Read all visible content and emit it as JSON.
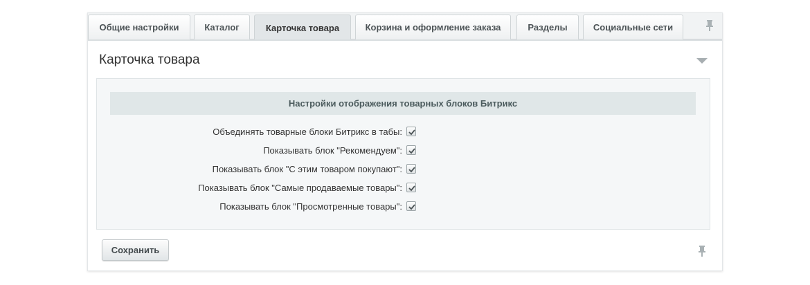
{
  "tabs": [
    {
      "label": "Общие настройки",
      "active": false
    },
    {
      "label": "Каталог",
      "active": false
    },
    {
      "label": "Карточка товара",
      "active": true
    },
    {
      "label": "Корзина и оформление заказа",
      "active": false
    },
    {
      "label": "Разделы",
      "active": false
    },
    {
      "label": "Социальные сети",
      "active": false
    }
  ],
  "pin_icon": "pin-icon",
  "page": {
    "title": "Карточка товара",
    "collapse_icon": "triangle-down-icon"
  },
  "section": {
    "heading": "Настройки отображения товарных блоков Битрикс",
    "options": [
      {
        "label": "Объединять товарные блоки Битрикс в табы:",
        "checked": true
      },
      {
        "label": "Показывать блок \"Рекомендуем\":",
        "checked": true
      },
      {
        "label": "Показывать блок \"С этим товаром покупают\":",
        "checked": true
      },
      {
        "label": "Показывать блок \"Самые продаваемые товары\":",
        "checked": true
      },
      {
        "label": "Показывать блок \"Просмотренные товары\":",
        "checked": true
      }
    ]
  },
  "footer": {
    "save_label": "Сохранить"
  },
  "colors": {
    "tab_active_bg": "#e2e6e8",
    "section_head_bg": "#e0e7e8",
    "panel_bg": "#f5f7f8"
  }
}
